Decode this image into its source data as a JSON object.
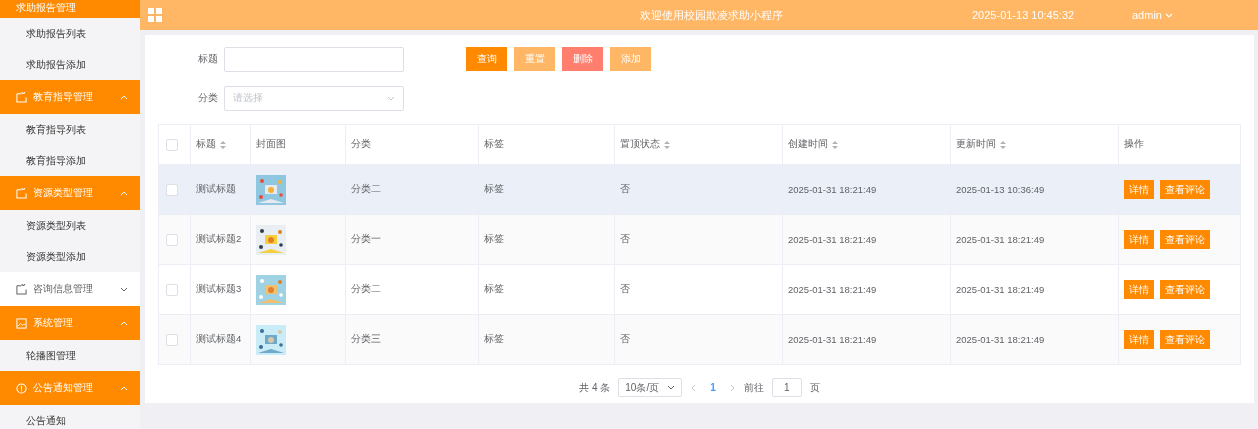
{
  "sidebar": {
    "groups": [
      {
        "title": "求助报告管理",
        "expanded": true,
        "items": [
          {
            "label": "求助报告列表"
          },
          {
            "label": "求助报告添加"
          }
        ]
      },
      {
        "title": "教育指导管理",
        "expanded": true,
        "items": [
          {
            "label": "教育指导列表"
          },
          {
            "label": "教育指导添加"
          }
        ]
      },
      {
        "title": "资源类型管理",
        "expanded": true,
        "items": [
          {
            "label": "资源类型列表"
          },
          {
            "label": "资源类型添加"
          }
        ]
      },
      {
        "title": "咨询信息管理",
        "expanded": false
      },
      {
        "title": "系统管理",
        "expanded": true,
        "items": [
          {
            "label": "轮播图管理"
          }
        ]
      },
      {
        "title": "公告通知管理",
        "expanded": true,
        "items": [
          {
            "label": "公告通知"
          }
        ]
      }
    ]
  },
  "header": {
    "title": "欢迎使用校园欺凌求助小程序",
    "datetime": "2025-01-13 10:45:32",
    "user": "admin"
  },
  "filters": [
    {
      "label": "标题",
      "kind": "input"
    },
    {
      "label": "分类",
      "kind": "select",
      "placeholder": "请选择"
    }
  ],
  "buttons": [
    {
      "label": "查询",
      "kind": "primary"
    },
    {
      "label": "重置",
      "kind": "light"
    },
    {
      "label": "删除",
      "kind": "danger"
    },
    {
      "label": "添加",
      "kind": "light"
    }
  ],
  "table": {
    "select_all_checked": false,
    "columns": [
      {
        "label": "标题",
        "sortable": true
      },
      {
        "label": "封面图",
        "sortable": false
      },
      {
        "label": "分类",
        "sortable": false
      },
      {
        "label": "标签",
        "sortable": false
      },
      {
        "label": "置顶状态",
        "sortable": true
      },
      {
        "label": "创建时间",
        "sortable": true
      },
      {
        "label": "更新时间",
        "sortable": true
      },
      {
        "label": "操作",
        "sortable": false
      }
    ],
    "rows": [
      {
        "checked": false,
        "hovered": true,
        "title": "测试标题",
        "category": "分类二",
        "tag": "标签",
        "pinned": "否",
        "created": "2025-01-31 18:21:49",
        "updated": "2025-01-13 10:36:49",
        "actions": [
          "详情",
          "查看评论"
        ]
      },
      {
        "checked": false,
        "hovered": false,
        "title": "测试标题2",
        "category": "分类一",
        "tag": "标签",
        "pinned": "否",
        "created": "2025-01-31 18:21:49",
        "updated": "2025-01-31 18:21:49",
        "actions": [
          "详情",
          "查看评论"
        ]
      },
      {
        "checked": false,
        "hovered": false,
        "title": "测试标题3",
        "category": "分类二",
        "tag": "标签",
        "pinned": "否",
        "created": "2025-01-31 18:21:49",
        "updated": "2025-01-31 18:21:49",
        "actions": [
          "详情",
          "查看评论"
        ]
      },
      {
        "checked": false,
        "hovered": false,
        "title": "测试标题4",
        "category": "分类三",
        "tag": "标签",
        "pinned": "否",
        "created": "2025-01-31 18:21:49",
        "updated": "2025-01-31 18:21:49",
        "actions": [
          "详情",
          "查看评论"
        ]
      }
    ]
  },
  "pagination": {
    "total": "共 4 条",
    "page_size": "10条/页",
    "pages": [
      {
        "label": "1",
        "selected": true
      }
    ],
    "goto_label": "前往",
    "goto_value": "1",
    "page_suffix": "页"
  }
}
